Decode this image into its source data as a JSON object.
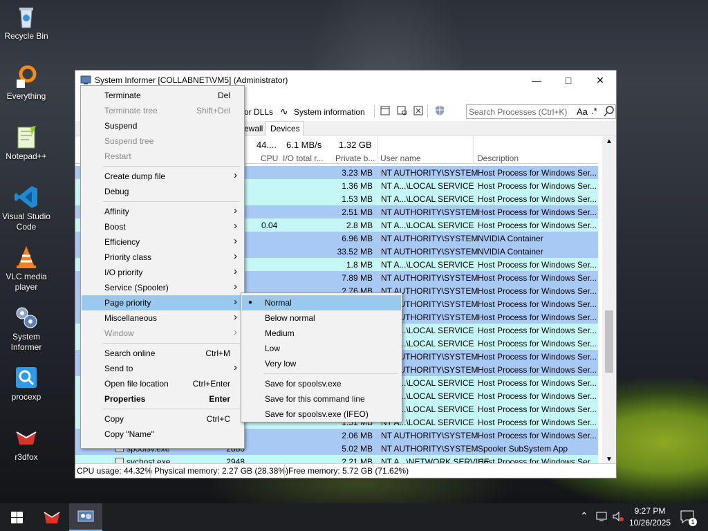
{
  "desktop": {
    "icons": [
      {
        "label": "Recycle Bin"
      },
      {
        "label": "Everything"
      },
      {
        "label": "Notepad++"
      },
      {
        "label": "Visual Studio Code"
      },
      {
        "label": "VLC media player"
      },
      {
        "label": "System Informer"
      },
      {
        "label": "procexp"
      },
      {
        "label": "r3dfox"
      }
    ]
  },
  "window": {
    "title": "System Informer [COLLABNET\\VM5] (Administrator)"
  },
  "toolbar": {
    "dlls": "or DLLs",
    "sysinfo": "System information",
    "search_placeholder": "Search Processes (Ctrl+K)",
    "aa": "Aa",
    "regex": ".*"
  },
  "tabs": {
    "firewall": "ewall",
    "devices": "Devices"
  },
  "header": {
    "cpu_total": "44....",
    "io_total": "6.1 MB/s",
    "private_total": "1.32 GB",
    "cpu": "CPU",
    "io": "I/O total r...",
    "private": "Private b...",
    "user": "User name",
    "desc": "Description"
  },
  "rows": [
    {
      "cpu": "",
      "private": "3.23 MB",
      "user": "NT AUTHORITY\\SYSTEM",
      "desc": "Host Process for Windows Ser...",
      "color": "#a9c9f5"
    },
    {
      "cpu": "",
      "private": "1.36 MB",
      "user": "NT A...\\LOCAL SERVICE",
      "desc": "Host Process for Windows Ser...",
      "color": "#c6f7f7"
    },
    {
      "cpu": "",
      "private": "1.53 MB",
      "user": "NT A...\\LOCAL SERVICE",
      "desc": "Host Process for Windows Ser...",
      "color": "#c6f7f7"
    },
    {
      "cpu": "",
      "private": "2.51 MB",
      "user": "NT AUTHORITY\\SYSTEM",
      "desc": "Host Process for Windows Ser...",
      "color": "#a9c9f5"
    },
    {
      "cpu": "0.04",
      "private": "2.8 MB",
      "user": "NT A...\\LOCAL SERVICE",
      "desc": "Host Process for Windows Ser...",
      "color": "#c6f7f7"
    },
    {
      "cpu": "",
      "private": "6.96 MB",
      "user": "NT AUTHORITY\\SYSTEM",
      "desc": "NVIDIA Container",
      "color": "#a9c9f5"
    },
    {
      "cpu": "",
      "private": "33.52 MB",
      "user": "NT AUTHORITY\\SYSTEM",
      "desc": "NVIDIA Container",
      "color": "#a9c9f5"
    },
    {
      "cpu": "",
      "private": "1.8 MB",
      "user": "NT A...\\LOCAL SERVICE",
      "desc": "Host Process for Windows Ser...",
      "color": "#c6f7f7"
    },
    {
      "cpu": "",
      "private": "7.89 MB",
      "user": "NT AUTHORITY\\SYSTEM",
      "desc": "Host Process for Windows Ser...",
      "color": "#a9c9f5"
    },
    {
      "cpu": "",
      "private": "2.76 MB",
      "user": "NT AUTHORITY\\SYSTEM",
      "desc": "Host Process for Windows Ser...",
      "color": "#a9c9f5"
    },
    {
      "cpu": "",
      "private": "",
      "user": "NT AUTHORITY\\SYSTEM",
      "desc": "Host Process for Windows Ser...",
      "color": "#a9c9f5"
    },
    {
      "cpu": "",
      "private": "",
      "user": "NT AUTHORITY\\SYSTEM",
      "desc": "Host Process for Windows Ser...",
      "color": "#a9c9f5"
    },
    {
      "cpu": "",
      "private": "",
      "user": "NT A...\\LOCAL SERVICE",
      "desc": "Host Process for Windows Ser...",
      "color": "#c6f7f7"
    },
    {
      "cpu": "",
      "private": "",
      "user": "NT A...\\LOCAL SERVICE",
      "desc": "Host Process for Windows Ser...",
      "color": "#c6f7f7"
    },
    {
      "cpu": "",
      "private": "",
      "user": "NT AUTHORITY\\SYSTEM",
      "desc": "Host Process for Windows Ser...",
      "color": "#a9c9f5"
    },
    {
      "cpu": "",
      "private": "",
      "user": "NT AUTHORITY\\SYSTEM",
      "desc": "Host Process for Windows Ser...",
      "color": "#a9c9f5"
    },
    {
      "cpu": "",
      "private": "",
      "user": "NT A...\\LOCAL SERVICE",
      "desc": "Host Process for Windows Ser...",
      "color": "#c6f7f7"
    },
    {
      "cpu": "",
      "private": "",
      "user": "NT A...\\LOCAL SERVICE",
      "desc": "Host Process for Windows Ser...",
      "color": "#c6f7f7"
    },
    {
      "cpu": "",
      "private": "",
      "user": "NT A...\\LOCAL SERVICE",
      "desc": "Host Process for Windows Ser...",
      "color": "#c6f7f7"
    },
    {
      "cpu": "",
      "private": "1.51 MB",
      "user": "NT A...\\LOCAL SERVICE",
      "desc": "Host Process for Windows Ser...",
      "color": "#c6f7f7"
    },
    {
      "cpu": "",
      "private": "2.06 MB",
      "user": "NT AUTHORITY\\SYSTEM",
      "desc": "Host Process for Windows Ser...",
      "color": "#a9c9f5"
    },
    {
      "cpu": "",
      "private": "5.02 MB",
      "user": "NT AUTHORITY\\SYSTEM",
      "desc": "Spooler SubSystem App",
      "color": "#a9c9f5",
      "name": "spoolsv.exe",
      "pid": "2880"
    },
    {
      "cpu": "",
      "private": "2.21 MB",
      "user": "NT A...\\NETWORK SERVICE",
      "desc": "Host Process for Windows Ser...",
      "color": "#c6f7f7",
      "name": "svchost.exe",
      "pid": "2948"
    }
  ],
  "status": {
    "cpu": "CPU usage: 44.32%",
    "phys": "Physical memory: 2.27 GB (28.38%)",
    "free": "Free memory: 5.72 GB (71.62%)"
  },
  "context_menu": [
    {
      "label": "Terminate",
      "shortcut": "Del",
      "disabled": false
    },
    {
      "label": "Terminate tree",
      "shortcut": "Shift+Del",
      "disabled": true
    },
    {
      "label": "Suspend",
      "shortcut": "",
      "disabled": false
    },
    {
      "label": "Suspend tree",
      "shortcut": "",
      "disabled": true
    },
    {
      "label": "Restart",
      "shortcut": "",
      "disabled": true
    },
    {
      "label": "Create dump file",
      "shortcut": "",
      "submenu": true
    },
    {
      "label": "Debug",
      "shortcut": ""
    },
    {
      "label": "Affinity",
      "submenu": true
    },
    {
      "label": "Boost",
      "submenu": true
    },
    {
      "label": "Efficiency",
      "submenu": true
    },
    {
      "label": "Priority class",
      "submenu": true
    },
    {
      "label": "I/O priority",
      "submenu": true
    },
    {
      "label": "Service (Spooler)",
      "submenu": true
    },
    {
      "label": "Page priority",
      "submenu": true,
      "highlight": true
    },
    {
      "label": "Miscellaneous",
      "submenu": true
    },
    {
      "label": "Window",
      "submenu": true,
      "disabled": true
    },
    {
      "label": "Search online",
      "shortcut": "Ctrl+M"
    },
    {
      "label": "Send to",
      "submenu": true
    },
    {
      "label": "Open file location",
      "shortcut": "Ctrl+Enter"
    },
    {
      "label": "Properties",
      "shortcut": "Enter",
      "bold": true
    },
    {
      "label": "Copy",
      "shortcut": "Ctrl+C"
    },
    {
      "label": "Copy \"Name\"",
      "shortcut": ""
    }
  ],
  "submenu": [
    {
      "label": "Normal",
      "checked": true
    },
    {
      "label": "Below normal"
    },
    {
      "label": "Medium"
    },
    {
      "label": "Low"
    },
    {
      "label": "Very low"
    },
    {
      "label": "Save for spoolsv.exe"
    },
    {
      "label": "Save for this command line"
    },
    {
      "label": "Save for spoolsv.exe (IFEO)"
    }
  ],
  "taskbar": {
    "time": "9:27 PM",
    "date": "10/26/2025",
    "notif_count": "1"
  }
}
